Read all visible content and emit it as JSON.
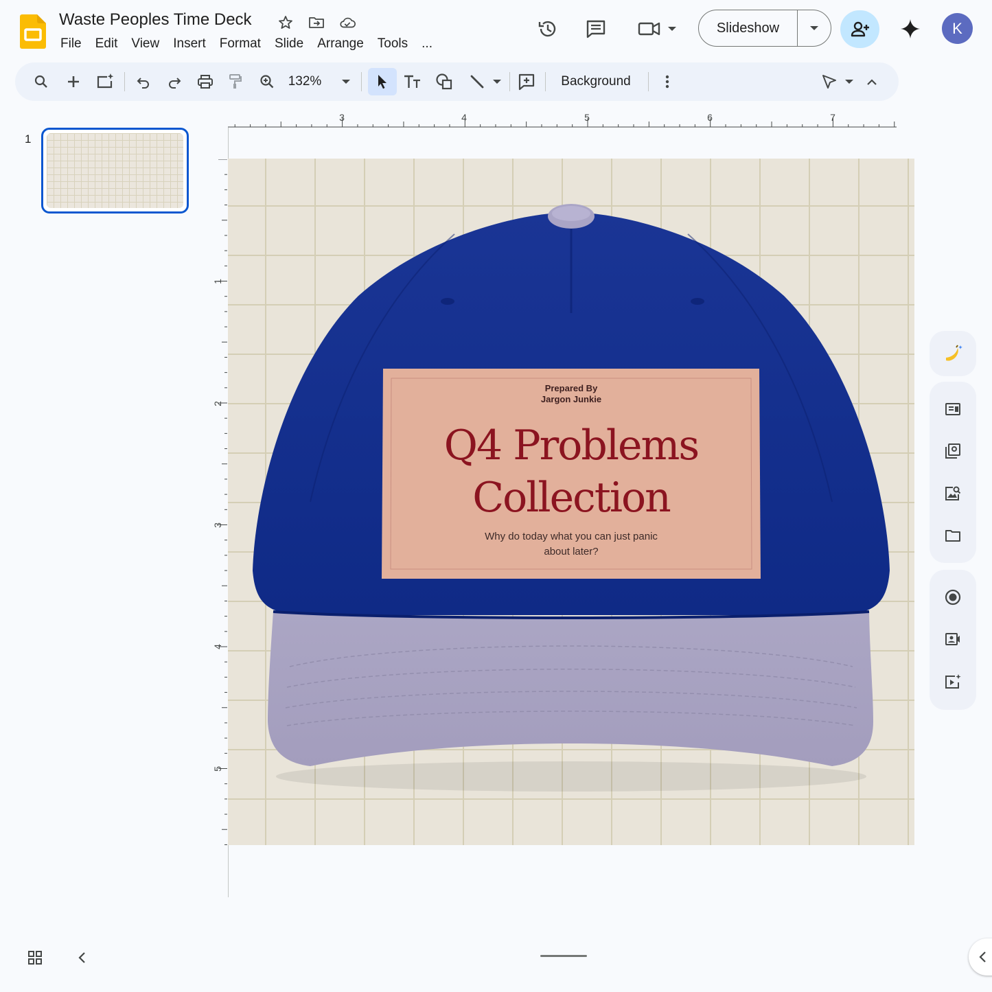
{
  "app": {
    "name": "Google Slides",
    "icon": "slides-logo-icon",
    "accent_color": "#fbbc04"
  },
  "document": {
    "title": "Waste Peoples Time Deck"
  },
  "menu": [
    "File",
    "Edit",
    "View",
    "Insert",
    "Format",
    "Slide",
    "Arrange",
    "Tools",
    "..."
  ],
  "header": {
    "slideshow_label": "Slideshow",
    "avatar_initial": "K",
    "avatar_color": "#5c6bc0",
    "share_bg": "#c2e7ff"
  },
  "toolbar": {
    "zoom": "132%",
    "background_label": "Background"
  },
  "rulers": {
    "horizontal_labels": [
      "3",
      "4",
      "5",
      "6",
      "7"
    ],
    "vertical_labels": [
      "1",
      "2",
      "3",
      "4",
      "5"
    ]
  },
  "thumbnails": [
    {
      "number": "1",
      "selected": true
    }
  ],
  "slide": {
    "prepared_by": "Prepared By\nJargon Junkie",
    "title": "Q4 Problems Collection",
    "subtitle": "Why do today what you can just panic about later?",
    "colors": {
      "hat_crown": "#12308e",
      "hat_brim": "#aaa5c3",
      "label": "#e2b19c",
      "title": "#8b1420",
      "background": "#e9e4d9"
    }
  }
}
